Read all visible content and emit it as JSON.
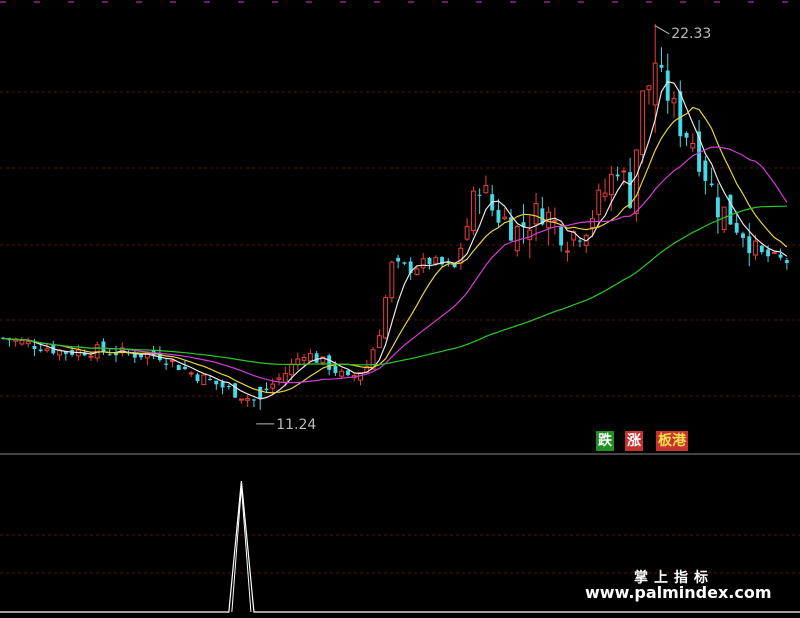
{
  "chart_data": {
    "type": "candlestick",
    "price_range": [
      10.0,
      22.9
    ],
    "n_bars": 126,
    "colors": {
      "up": "#e8403a",
      "down": "#46d8e6",
      "ma_white": "#e8e8e8",
      "ma_yellow": "#e6d23c",
      "ma_magenta": "#d23cd2",
      "ma_green": "#28c828",
      "grid": "#5a0f0f",
      "divider": "#8a8a8a"
    },
    "annotations": {
      "high_label": "22.33",
      "low_label": "11.24"
    },
    "anchors": {
      "high": 22.33,
      "low": 11.24,
      "high_bar": 104,
      "low_bar": 41
    },
    "close_path": [
      [
        0,
        13.3
      ],
      [
        5,
        13.1
      ],
      [
        10,
        12.9
      ],
      [
        15,
        12.95
      ],
      [
        20,
        12.85
      ],
      [
        25,
        12.8
      ],
      [
        30,
        12.3
      ],
      [
        35,
        11.9
      ],
      [
        40,
        11.5
      ],
      [
        45,
        12.3
      ],
      [
        48,
        12.9
      ],
      [
        52,
        12.5
      ],
      [
        55,
        12.1
      ],
      [
        58,
        12.5
      ],
      [
        60,
        13.5
      ],
      [
        62,
        15.4
      ],
      [
        65,
        15.3
      ],
      [
        68,
        15.5
      ],
      [
        72,
        15.3
      ],
      [
        76,
        17.8
      ],
      [
        78,
        17.0
      ],
      [
        82,
        16.4
      ],
      [
        86,
        17.0
      ],
      [
        90,
        16.2
      ],
      [
        93,
        16.6
      ],
      [
        96,
        17.5
      ],
      [
        98,
        18.3
      ],
      [
        100,
        17.4
      ],
      [
        102,
        20.2
      ],
      [
        104,
        21.0
      ],
      [
        106,
        20.3
      ],
      [
        108,
        19.4
      ],
      [
        110,
        19.0
      ],
      [
        114,
        17.1
      ],
      [
        118,
        16.4
      ],
      [
        121,
        15.7
      ],
      [
        125,
        15.5
      ]
    ],
    "indicator": {
      "signal_bar": 38,
      "signal_value": 1.0,
      "range": [
        0,
        1.0
      ]
    }
  },
  "tags": {
    "fall": "跌",
    "rise": "涨",
    "board": "板港"
  },
  "watermark": {
    "cn": "掌上指标",
    "url": "www.palmindex.com"
  }
}
